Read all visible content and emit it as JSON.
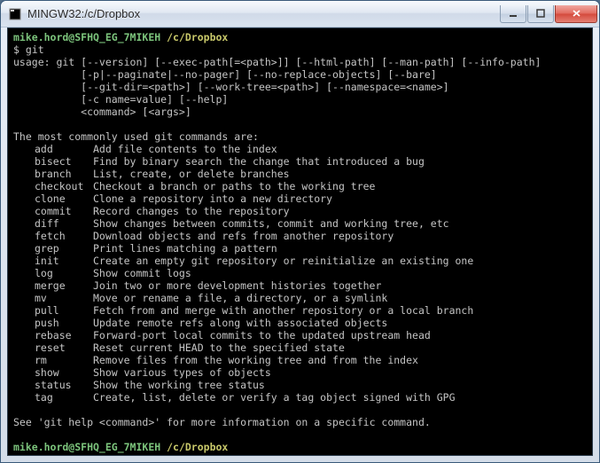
{
  "window": {
    "title": "MINGW32:/c/Dropbox"
  },
  "prompt": {
    "user": "mike.hord@SFHQ_EG_7MIKEH",
    "path": "/c/Dropbox",
    "symbol": "$"
  },
  "command": "git",
  "usage": {
    "line1": "usage: git [--version] [--exec-path[=<path>]] [--html-path] [--man-path] [--info-path]",
    "line2": "           [-p|--paginate|--no-pager] [--no-replace-objects] [--bare]",
    "line3": "           [--git-dir=<path>] [--work-tree=<path>] [--namespace=<name>]",
    "line4": "           [-c name=value] [--help]",
    "line5": "           <command> [<args>]"
  },
  "common_heading": "The most commonly used git commands are:",
  "commands": [
    {
      "name": "add",
      "desc": "Add file contents to the index"
    },
    {
      "name": "bisect",
      "desc": "Find by binary search the change that introduced a bug"
    },
    {
      "name": "branch",
      "desc": "List, create, or delete branches"
    },
    {
      "name": "checkout",
      "desc": "Checkout a branch or paths to the working tree"
    },
    {
      "name": "clone",
      "desc": "Clone a repository into a new directory"
    },
    {
      "name": "commit",
      "desc": "Record changes to the repository"
    },
    {
      "name": "diff",
      "desc": "Show changes between commits, commit and working tree, etc"
    },
    {
      "name": "fetch",
      "desc": "Download objects and refs from another repository"
    },
    {
      "name": "grep",
      "desc": "Print lines matching a pattern"
    },
    {
      "name": "init",
      "desc": "Create an empty git repository or reinitialize an existing one"
    },
    {
      "name": "log",
      "desc": "Show commit logs"
    },
    {
      "name": "merge",
      "desc": "Join two or more development histories together"
    },
    {
      "name": "mv",
      "desc": "Move or rename a file, a directory, or a symlink"
    },
    {
      "name": "pull",
      "desc": "Fetch from and merge with another repository or a local branch"
    },
    {
      "name": "push",
      "desc": "Update remote refs along with associated objects"
    },
    {
      "name": "rebase",
      "desc": "Forward-port local commits to the updated upstream head"
    },
    {
      "name": "reset",
      "desc": "Reset current HEAD to the specified state"
    },
    {
      "name": "rm",
      "desc": "Remove files from the working tree and from the index"
    },
    {
      "name": "show",
      "desc": "Show various types of objects"
    },
    {
      "name": "status",
      "desc": "Show the working tree status"
    },
    {
      "name": "tag",
      "desc": "Create, list, delete or verify a tag object signed with GPG"
    }
  ],
  "footer_help": "See 'git help <command>' for more information on a specific command."
}
